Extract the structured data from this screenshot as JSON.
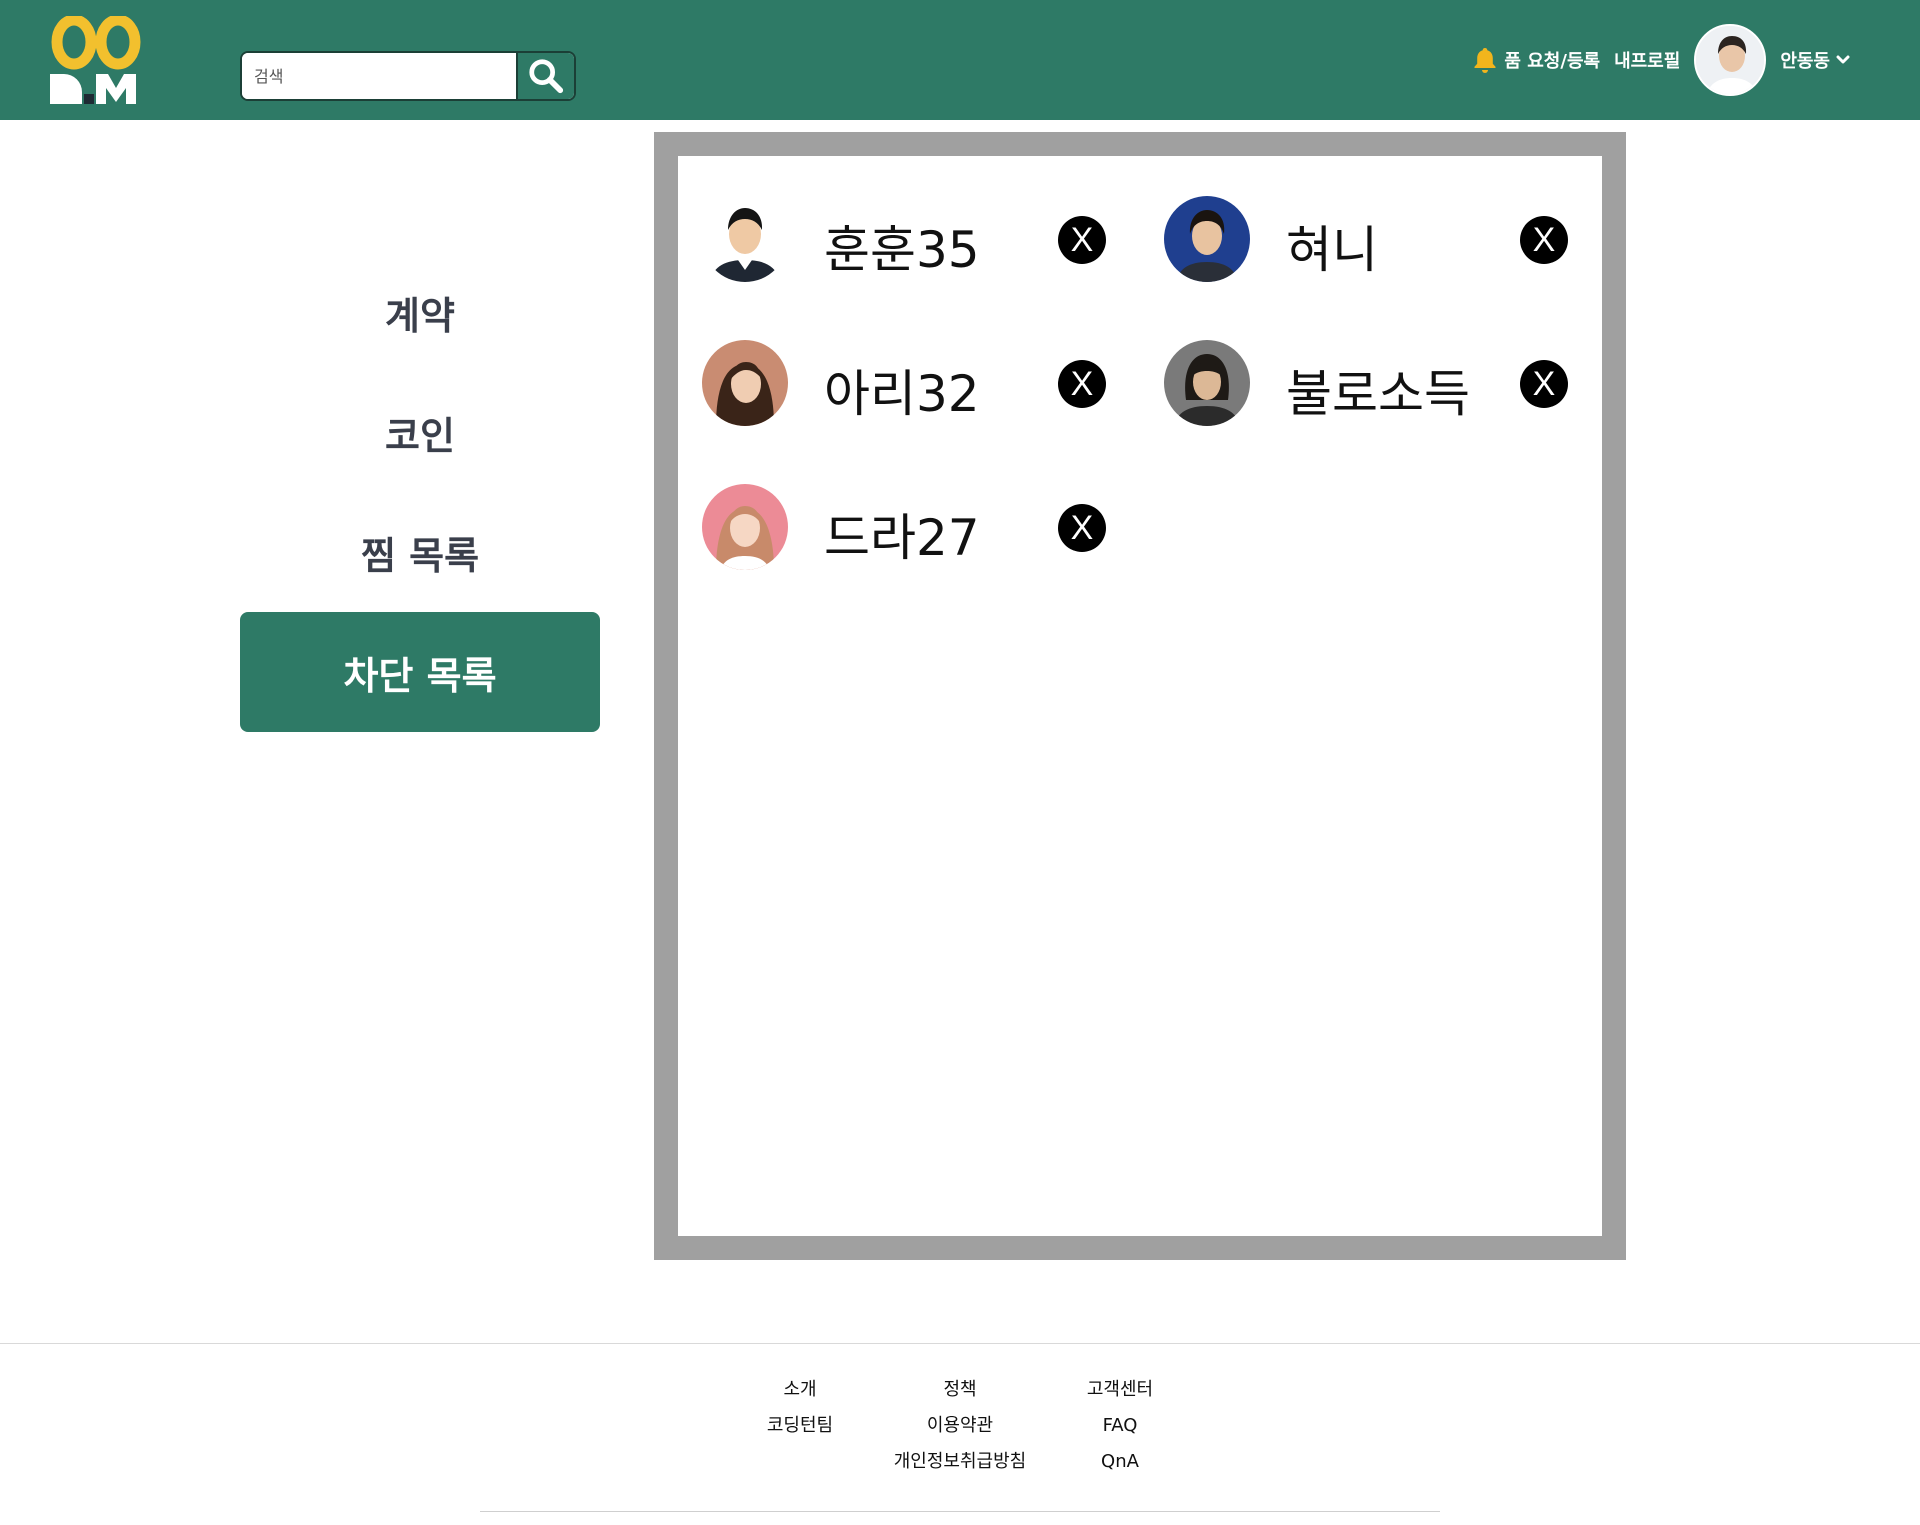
{
  "header": {
    "search": {
      "placeholder": "검색",
      "value": ""
    },
    "nav": {
      "request_register": "품 요청/등록",
      "my_profile": "내프로필",
      "user_name": "안동동"
    },
    "colors": {
      "brand_green": "#2e7a66",
      "logo_yellow": "#f2c02e",
      "bell_yellow": "#f2b51c"
    }
  },
  "sidebar": {
    "items": [
      {
        "label": "계약",
        "active": false
      },
      {
        "label": "코인",
        "active": false
      },
      {
        "label": "찜 목록",
        "active": false
      },
      {
        "label": "차단 목록",
        "active": true
      }
    ]
  },
  "blocked": {
    "remove_label": "X",
    "users": [
      {
        "name": "훈훈35",
        "avatar": "avatar-man-suit"
      },
      {
        "name": "혀니",
        "avatar": "avatar-man-blue"
      },
      {
        "name": "아리32",
        "avatar": "avatar-woman-dark"
      },
      {
        "name": "불로소득",
        "avatar": "avatar-man-longhair"
      },
      {
        "name": "드라27",
        "avatar": "avatar-woman-pink"
      }
    ]
  },
  "footer": {
    "columns": [
      {
        "heading": "소개",
        "links": [
          "코딩턴팀"
        ]
      },
      {
        "heading": "정책",
        "links": [
          "이용약관",
          "개인정보취급방침"
        ]
      },
      {
        "heading": "고객센터",
        "links": [
          "FAQ",
          "QnA"
        ]
      }
    ]
  }
}
